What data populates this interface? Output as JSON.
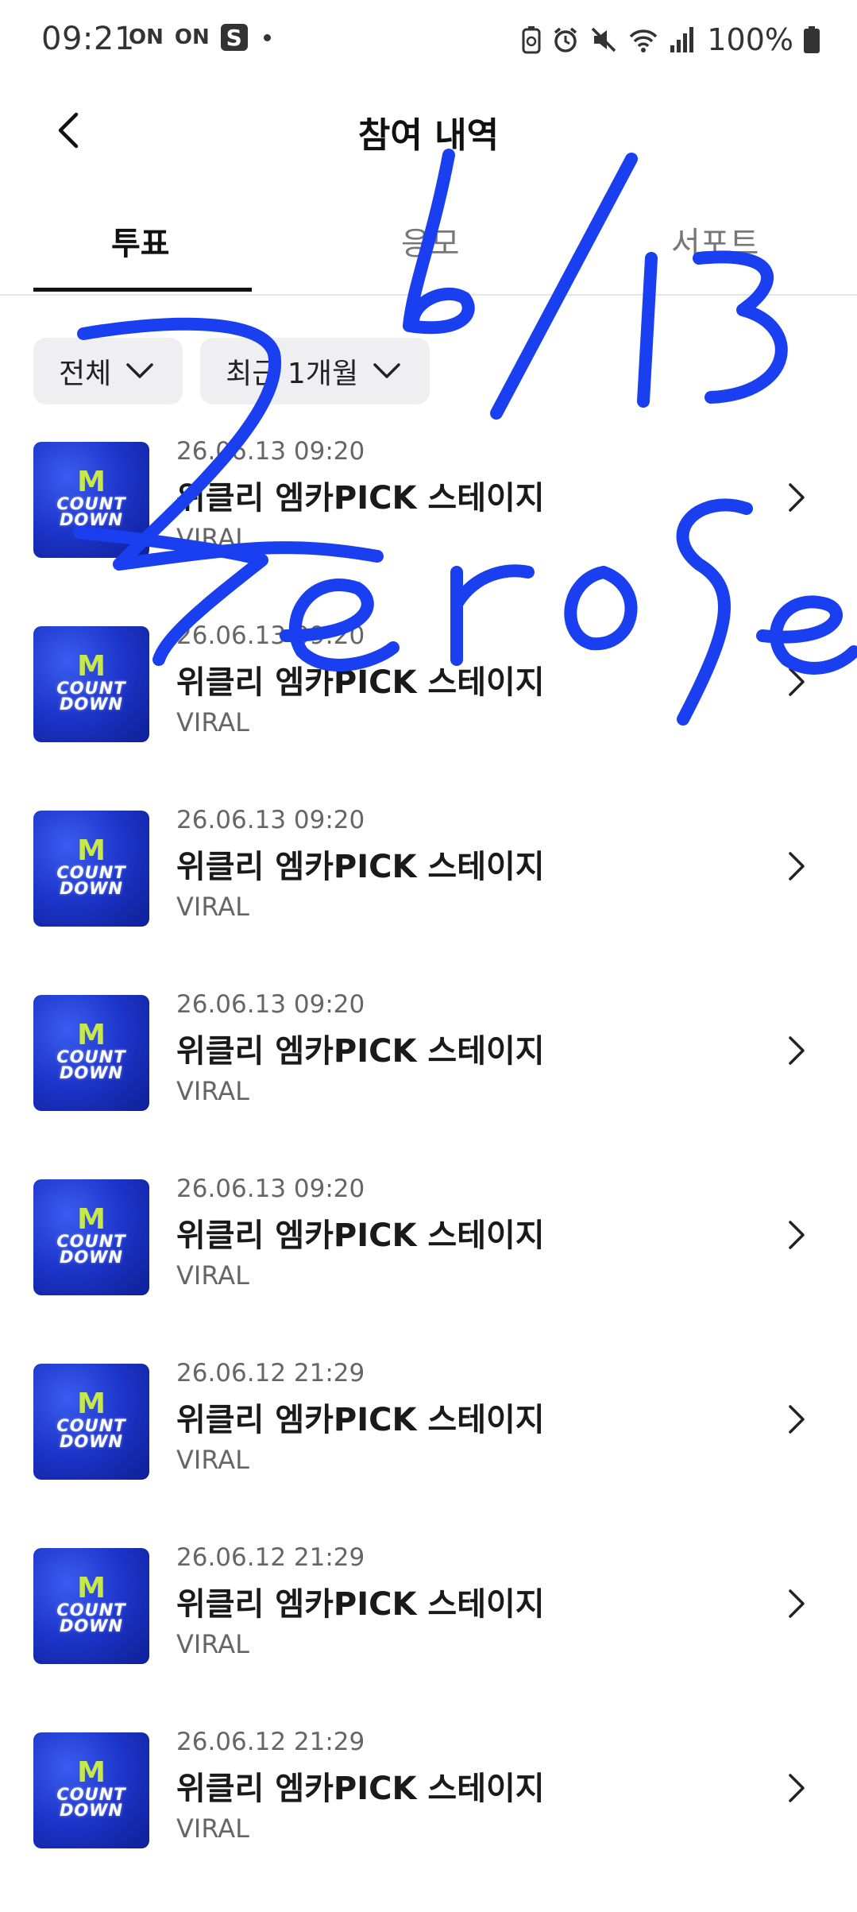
{
  "status_bar": {
    "time": "09:21",
    "left_icons": [
      "ON",
      "ON"
    ],
    "samsung_icon": "S",
    "battery_percent": "100%"
  },
  "header": {
    "title": "참여 내역",
    "back_icon": "chevron-left-icon"
  },
  "tabs": [
    {
      "label": "투표",
      "active": true
    },
    {
      "label": "응모",
      "active": false
    },
    {
      "label": "서포트",
      "active": false
    }
  ],
  "filters": [
    {
      "label": "전체"
    },
    {
      "label": "최근 1개월"
    }
  ],
  "items": [
    {
      "date": "26.06.13 09:20",
      "title": "위클리 엠카PICK 스테이지",
      "subtitle": "VIRAL",
      "thumb_line1": "M",
      "thumb_line2": "COUNT",
      "thumb_line3": "DOWN"
    },
    {
      "date": "26.06.13 09:20",
      "title": "위클리 엠카PICK 스테이지",
      "subtitle": "VIRAL",
      "thumb_line1": "M",
      "thumb_line2": "COUNT",
      "thumb_line3": "DOWN"
    },
    {
      "date": "26.06.13 09:20",
      "title": "위클리 엠카PICK 스테이지",
      "subtitle": "VIRAL",
      "thumb_line1": "M",
      "thumb_line2": "COUNT",
      "thumb_line3": "DOWN"
    },
    {
      "date": "26.06.13 09:20",
      "title": "위클리 엠카PICK 스테이지",
      "subtitle": "VIRAL",
      "thumb_line1": "M",
      "thumb_line2": "COUNT",
      "thumb_line3": "DOWN"
    },
    {
      "date": "26.06.13 09:20",
      "title": "위클리 엠카PICK 스테이지",
      "subtitle": "VIRAL",
      "thumb_line1": "M",
      "thumb_line2": "COUNT",
      "thumb_line3": "DOWN"
    },
    {
      "date": "26.06.12 21:29",
      "title": "위클리 엠카PICK 스테이지",
      "subtitle": "VIRAL",
      "thumb_line1": "M",
      "thumb_line2": "COUNT",
      "thumb_line3": "DOWN"
    },
    {
      "date": "26.06.12 21:29",
      "title": "위클리 엠카PICK 스테이지",
      "subtitle": "VIRAL",
      "thumb_line1": "M",
      "thumb_line2": "COUNT",
      "thumb_line3": "DOWN"
    },
    {
      "date": "26.06.12 21:29",
      "title": "위클리 엠카PICK 스테이지",
      "subtitle": "VIRAL",
      "thumb_line1": "M",
      "thumb_line2": "COUNT",
      "thumb_line3": "DOWN"
    }
  ],
  "annotation": {
    "text": "2 6/13 zerose",
    "color": "#1a3ff0"
  }
}
